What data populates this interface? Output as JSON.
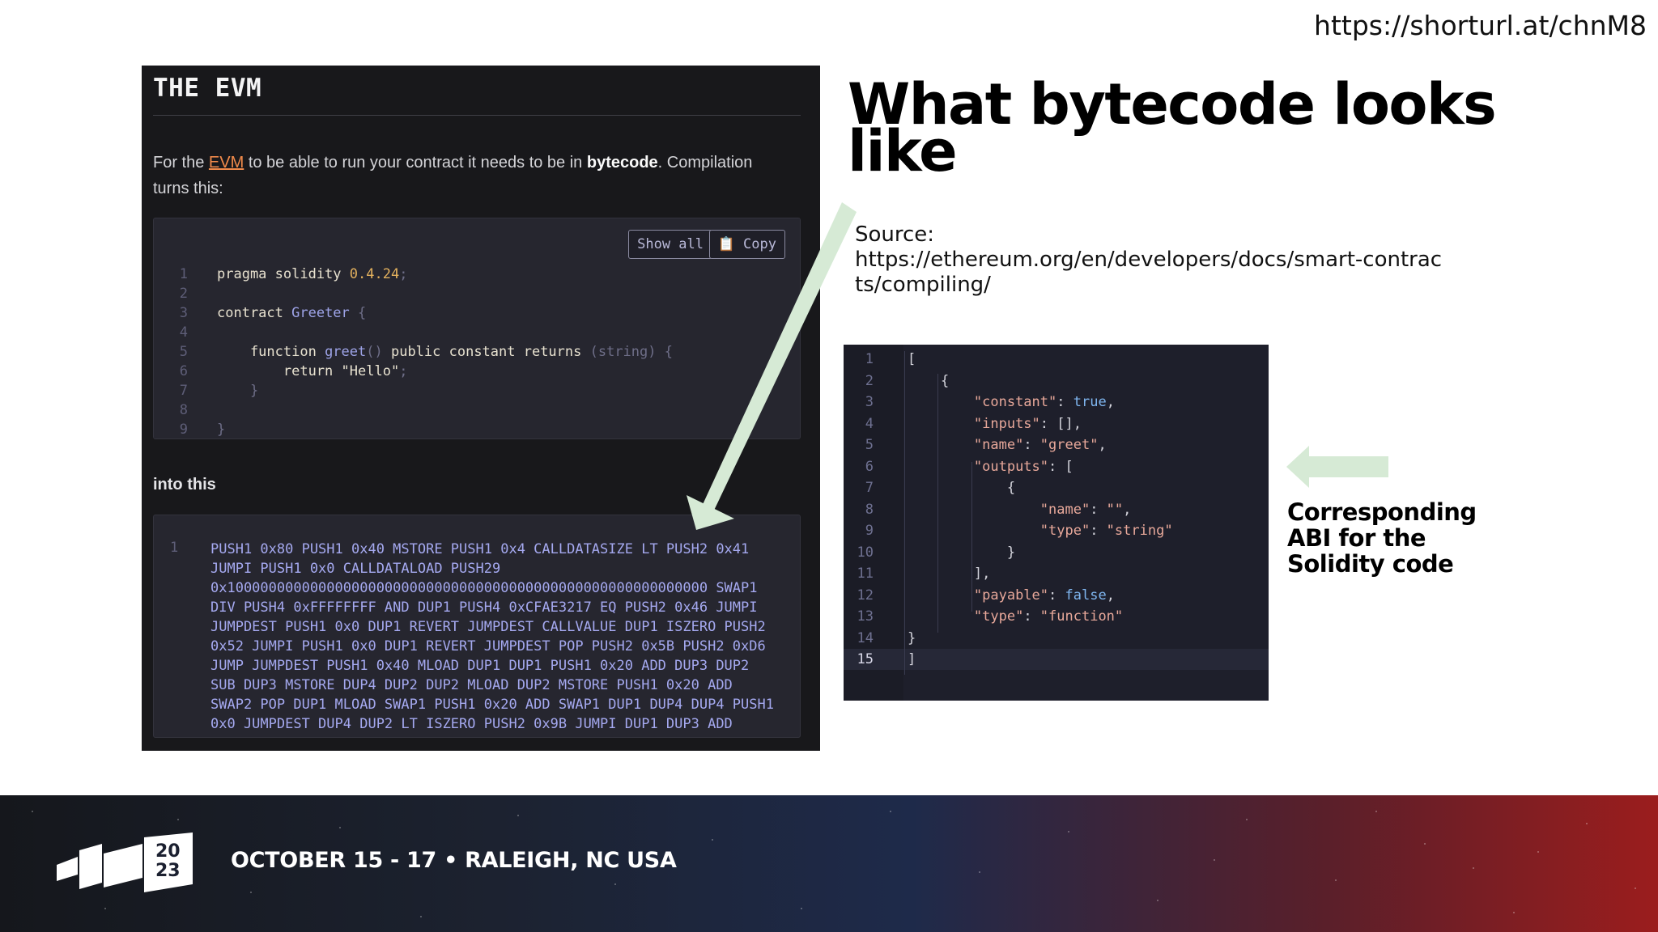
{
  "header": {
    "url": "https://shorturl.at/chnM8"
  },
  "evm_panel": {
    "title": "THE EVM",
    "intro_before": "For the ",
    "intro_link": "EVM",
    "intro_mid": " to be able to run your contract it needs to be in ",
    "intro_bold": "bytecode",
    "intro_after": ". Compilation turns this:",
    "show_all_label": "Show all",
    "copy_label": "📋 Copy",
    "into_label": "into this",
    "source_line_numbers": [
      "1",
      "2",
      "3",
      "4",
      "5",
      "6",
      "7",
      "8",
      "9"
    ],
    "bytecode_line_number": "1",
    "bytecode": "PUSH1 0x80 PUSH1 0x40 MSTORE PUSH1 0x4 CALLDATASIZE LT PUSH2 0x41\nJUMPI PUSH1 0x0 CALLDATALOAD PUSH29\n0x1000000000000000000000000000000000000000000000000000000000 SWAP1\nDIV PUSH4 0xFFFFFFFF AND DUP1 PUSH4 0xCFAE3217 EQ PUSH2 0x46 JUMPI\nJUMPDEST PUSH1 0x0 DUP1 REVERT JUMPDEST CALLVALUE DUP1 ISZERO PUSH2\n0x52 JUMPI PUSH1 0x0 DUP1 REVERT JUMPDEST POP PUSH2 0x5B PUSH2 0xD6\nJUMP JUMPDEST PUSH1 0x40 MLOAD DUP1 DUP1 PUSH1 0x20 ADD DUP3 DUP2\nSUB DUP3 MSTORE DUP4 DUP2 DUP2 MLOAD DUP2 MSTORE PUSH1 0x20 ADD\nSWAP2 POP DUP1 MLOAD SWAP1 PUSH1 0x20 ADD SWAP1 DUP1 DUP4 DUP4 PUSH1\n0x0 JUMPDEST DUP4 DUP2 LT ISZERO PUSH2 0x9B JUMPI DUP1 DUP3 ADD"
  },
  "solidity": {
    "l1_kw": "pragma solidity ",
    "l1_ver": "0.4.24",
    "l1_end": ";",
    "l3_kw": "contract ",
    "l3_name": "Greeter",
    "l3_end": " {",
    "l5_kw": "    function ",
    "l5_name": "greet",
    "l5_paren": "()",
    "l5_mods": " public constant returns ",
    "l5_ret": "(string)",
    "l5_brace": " {",
    "l6_kw": "        return ",
    "l6_str": "\"Hello\"",
    "l6_end": ";",
    "l7": "    }",
    "l9": "}"
  },
  "slide": {
    "title_line1": "What bytecode looks",
    "title_line2": "like",
    "source_label": "Source:",
    "source_url_line1": "https://ethereum.org/en/developers/docs/smart-contrac",
    "source_url_line2": "ts/compiling/",
    "caption_line1": "Corresponding",
    "caption_line2": "ABI for the",
    "caption_line3": "Solidity code"
  },
  "abi": {
    "line_numbers": [
      "1",
      "2",
      "3",
      "4",
      "5",
      "6",
      "7",
      "8",
      "9",
      "10",
      "11",
      "12",
      "13",
      "14",
      "15"
    ],
    "l1": "[",
    "l2": "    {",
    "l3_key": "\"constant\"",
    "l3_sep": ": ",
    "l3_val": "true",
    "l3_end": ",",
    "l4_key": "\"inputs\"",
    "l4_rest": ": [],",
    "l5_key": "\"name\"",
    "l5_sep": ": ",
    "l5_val": "\"greet\"",
    "l5_end": ",",
    "l6_key": "\"outputs\"",
    "l6_rest": ": [",
    "l7": "{",
    "l8_key": "\"name\"",
    "l8_sep": ": ",
    "l8_val": "\"\"",
    "l8_end": ",",
    "l9_key": "\"type\"",
    "l9_sep": ": ",
    "l9_val": "\"string\"",
    "l10": "}",
    "l11": "],",
    "l12_key": "\"payable\"",
    "l12_sep": ": ",
    "l12_val": "false",
    "l12_end": ",",
    "l13_key": "\"type\"",
    "l13_sep": ": ",
    "l13_val": "\"function\"",
    "l14": "}",
    "l15": "]"
  },
  "footer": {
    "event_text": "OCTOBER 15 - 17 • RALEIGH, NC USA",
    "logo_year_top": "20",
    "logo_year_bottom": "23"
  },
  "colors": {
    "arrow": "#d6ead5",
    "link": "#f08a4b",
    "bytecode": "#a5a9f0"
  }
}
